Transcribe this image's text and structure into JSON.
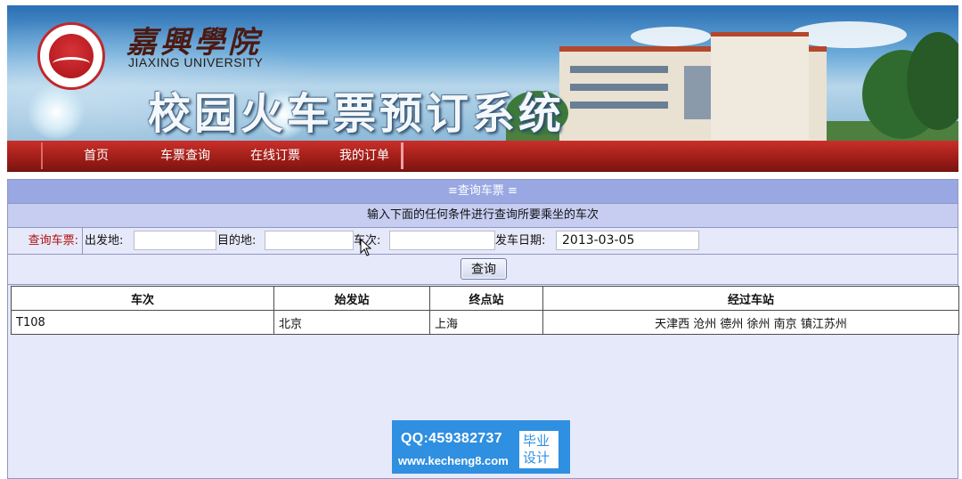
{
  "banner": {
    "university_cn": "嘉興學院",
    "university_en": "JIAXING UNIVERSITY",
    "system_title": "校园火车票预订系统"
  },
  "nav": {
    "items": [
      {
        "label": "首页"
      },
      {
        "label": "车票查询"
      },
      {
        "label": "在线订票"
      },
      {
        "label": "我的订单"
      }
    ]
  },
  "panel": {
    "header": "≡查询车票 ≡",
    "instruction": "输入下面的任何条件进行查询所要乘坐的车次"
  },
  "search": {
    "section_label": "查询车票:",
    "from_label": "出发地:",
    "from_value": "",
    "to_label": "目的地:",
    "to_value": "",
    "train_label": "车次:",
    "train_value": "",
    "date_label": "发车日期:",
    "date_value": "2013-03-05",
    "button_label": "查询"
  },
  "table": {
    "headers": [
      "车次",
      "始发站",
      "终点站",
      "经过车站"
    ],
    "rows": [
      {
        "train": "T108",
        "origin": "北京",
        "terminal": "上海",
        "stops": "天津西 沧州 德州 徐州 南京 镇江苏州"
      }
    ]
  },
  "watermark": {
    "qq": "QQ:459382737",
    "url": "www.kecheng8.com",
    "badge_line1": "毕业",
    "badge_line2": "设计"
  },
  "colors": {
    "nav_red": "#a9211c",
    "panel_header": "#99a8e2",
    "panel_bg": "#e6e9fa",
    "label_red": "#b01010",
    "watermark_blue": "#2f8fe0"
  }
}
